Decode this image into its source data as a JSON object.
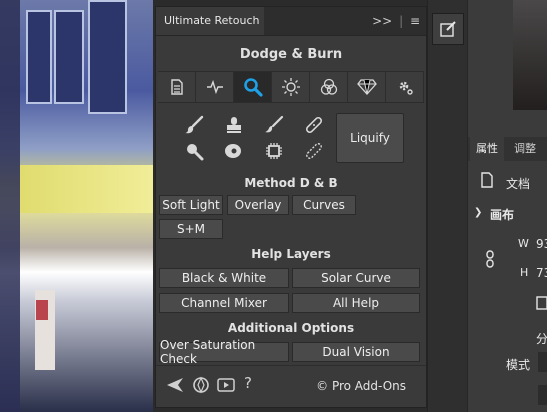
{
  "panel": {
    "title": "Ultimate Retouch",
    "header": "Dodge & Burn",
    "tabs": [
      "document-icon",
      "pulse-icon",
      "search-icon",
      "brightness-icon",
      "channels-icon",
      "diamond-icon",
      "settings-icon"
    ],
    "active_tab": 2,
    "liquify": "Liquify",
    "method": {
      "heading": "Method D & B",
      "buttons": [
        "Soft Light",
        "Overlay",
        "Curves",
        "S+M"
      ]
    },
    "help_layers": {
      "heading": "Help Layers",
      "buttons": [
        "Black & White",
        "Solar Curve",
        "Channel Mixer",
        "All Help"
      ]
    },
    "additional": {
      "heading": "Additional Options",
      "buttons": [
        "Over Saturation Check",
        "Dual Vision"
      ]
    },
    "footer": {
      "help": "?",
      "copyright": "© Pro Add-Ons"
    }
  },
  "properties": {
    "tab_props": "属性",
    "tab_adjust": "调整",
    "document": "文档",
    "canvas_heading": "画布",
    "w_label": "W",
    "w_value": "93",
    "h_label": "H",
    "h_value": "73",
    "fen": "分",
    "mode": "模式"
  },
  "colors": {
    "accent": "#1ea1e6",
    "panel_bg": "#3a3a3a",
    "button_bg": "#4a4a4a"
  }
}
